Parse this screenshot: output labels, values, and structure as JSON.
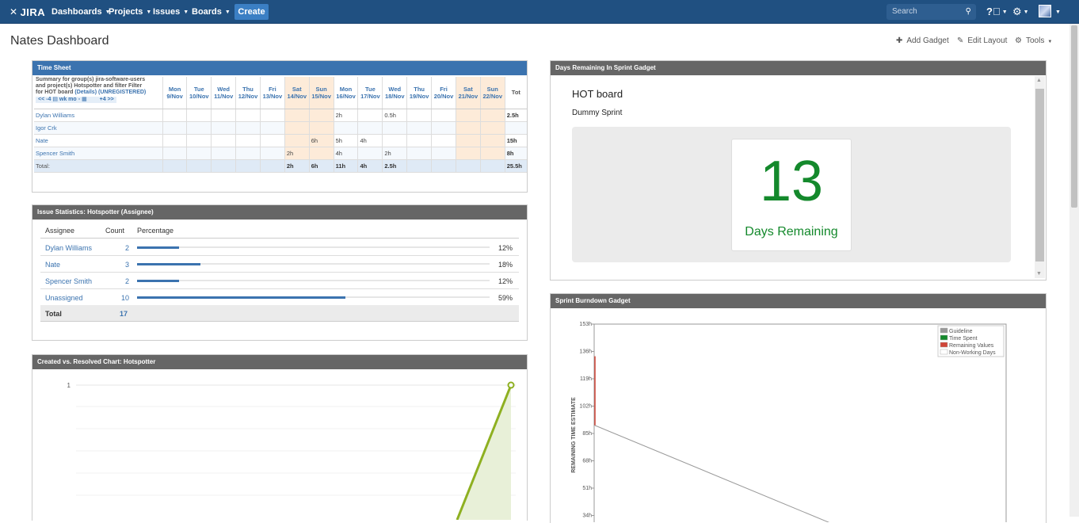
{
  "nav": {
    "logo": "JIRA",
    "items": [
      {
        "label": "Dashboards"
      },
      {
        "label": "Projects"
      },
      {
        "label": "Issues"
      },
      {
        "label": "Boards"
      }
    ],
    "create": "Create",
    "search_placeholder": "Search"
  },
  "page": {
    "title": "Nates Dashboard",
    "add_gadget": "Add Gadget",
    "edit_layout": "Edit Layout",
    "tools": "Tools"
  },
  "timesheet": {
    "title": "Time Sheet",
    "summary_line1": "Summary for group(s) jira-software-users",
    "summary_line2": "and project(s) Hotspotter and filter Filter",
    "summary_line3": "for HOT board",
    "details": "(Details)",
    "unregistered": "(UNREGISTERED)",
    "nav_prev": "<<  -4",
    "nav_mid": "wk  mo",
    "nav_next": "+4  >>",
    "days": [
      {
        "d": "Mon",
        "date": "9/Nov",
        "weekend": false
      },
      {
        "d": "Tue",
        "date": "10/Nov",
        "weekend": false
      },
      {
        "d": "Wed",
        "date": "11/Nov",
        "weekend": false
      },
      {
        "d": "Thu",
        "date": "12/Nov",
        "weekend": false
      },
      {
        "d": "Fri",
        "date": "13/Nov",
        "weekend": false
      },
      {
        "d": "Sat",
        "date": "14/Nov",
        "weekend": true
      },
      {
        "d": "Sun",
        "date": "15/Nov",
        "weekend": true
      },
      {
        "d": "Mon",
        "date": "16/Nov",
        "weekend": false
      },
      {
        "d": "Tue",
        "date": "17/Nov",
        "weekend": false
      },
      {
        "d": "Wed",
        "date": "18/Nov",
        "weekend": false
      },
      {
        "d": "Thu",
        "date": "19/Nov",
        "weekend": false
      },
      {
        "d": "Fri",
        "date": "20/Nov",
        "weekend": false
      },
      {
        "d": "Sat",
        "date": "21/Nov",
        "weekend": true
      },
      {
        "d": "Sun",
        "date": "22/Nov",
        "weekend": true
      }
    ],
    "total_header": "Tot",
    "rows": [
      {
        "name": "Dylan Williams",
        "values": [
          "",
          "",
          "",
          "",
          "",
          "",
          "",
          "2h",
          "",
          "0.5h",
          "",
          "",
          "",
          ""
        ],
        "total": "2.5h"
      },
      {
        "name": "Igor Crk",
        "values": [
          "",
          "",
          "",
          "",
          "",
          "",
          "",
          "",
          "",
          "",
          "",
          "",
          "",
          ""
        ],
        "total": ""
      },
      {
        "name": "Nate",
        "values": [
          "",
          "",
          "",
          "",
          "",
          "",
          "6h",
          "5h",
          "4h",
          "",
          "",
          "",
          "",
          ""
        ],
        "total": "15h"
      },
      {
        "name": "Spencer Smith",
        "values": [
          "",
          "",
          "",
          "",
          "",
          "2h",
          "",
          "4h",
          "",
          "2h",
          "",
          "",
          "",
          ""
        ],
        "total": "8h"
      }
    ],
    "total_row": {
      "name": "Total:",
      "values": [
        "",
        "",
        "",
        "",
        "",
        "2h",
        "6h",
        "11h",
        "4h",
        "2.5h",
        "",
        "",
        "",
        ""
      ],
      "total": "25.5h"
    }
  },
  "issue_stats": {
    "title": "Issue Statistics: Hotspotter (Assignee)",
    "col_assignee": "Assignee",
    "col_count": "Count",
    "col_percentage": "Percentage",
    "rows": [
      {
        "name": "Dylan Williams",
        "count": "2",
        "pct": "12%",
        "fraction": 0.12
      },
      {
        "name": "Nate",
        "count": "3",
        "pct": "18%",
        "fraction": 0.18
      },
      {
        "name": "Spencer Smith",
        "count": "2",
        "pct": "12%",
        "fraction": 0.12
      },
      {
        "name": "Unassigned",
        "count": "10",
        "pct": "59%",
        "fraction": 0.59
      }
    ],
    "total_label": "Total",
    "total_count": "17"
  },
  "created_resolved": {
    "title": "Created vs. Resolved Chart: Hotspotter",
    "y_tick": "1"
  },
  "days_remaining": {
    "title": "Days Remaining In Sprint Gadget",
    "board": "HOT board",
    "sprint": "Dummy Sprint",
    "days": "13",
    "label": "Days Remaining"
  },
  "burndown": {
    "title": "Sprint Burndown Gadget",
    "ylabel": "REMAINING TIME ESTIMATE",
    "legend": [
      {
        "label": "Guideline",
        "color": "#999999"
      },
      {
        "label": "Time Spent",
        "color": "#14892c"
      },
      {
        "label": "Remaining Values",
        "color": "#d04437"
      },
      {
        "label": "Non-Working Days",
        "color": "#ffffff"
      }
    ]
  },
  "chart_data": [
    {
      "type": "line",
      "title": "Sprint Burndown Gadget",
      "ylabel": "REMAINING TIME ESTIMATE",
      "y_ticks": [
        "153h",
        "136h",
        "119h",
        "102h",
        "85h",
        "68h",
        "51h",
        "34h"
      ],
      "ylim": [
        34,
        153
      ],
      "series": [
        {
          "name": "Remaining Values",
          "points": [
            [
              0,
              133
            ],
            [
              0,
              90
            ]
          ]
        },
        {
          "name": "Guideline",
          "points": [
            [
              0,
              90
            ],
            [
              1,
              34
            ]
          ]
        }
      ]
    },
    {
      "type": "area",
      "title": "Created vs. Resolved Chart: Hotspotter",
      "y_ticks": [
        "1"
      ],
      "series": [
        {
          "name": "",
          "points": [
            [
              0.82,
              0
            ],
            [
              1,
              1
            ]
          ]
        }
      ]
    }
  ]
}
